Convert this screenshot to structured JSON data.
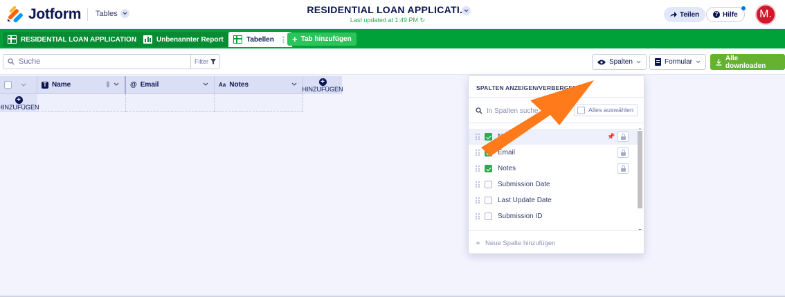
{
  "header": {
    "logo_text": "Jotform",
    "tables_label": "Tables",
    "title": "RESIDENTIAL LOAN APPLICATI...",
    "subtitle": "Last updated at 1:49 PM",
    "share_label": "Teilen",
    "help_label": "Hilfe",
    "avatar_initial": "M."
  },
  "tabs": [
    {
      "label": "RESIDENTIAL LOAN APPLICATION",
      "icon": "grid-icon"
    },
    {
      "label": "Unbenannter Report",
      "icon": "report-icon"
    },
    {
      "label": "Tabellen",
      "icon": "grid-icon",
      "active": true
    }
  ],
  "add_tab_label": "Tab hinzufügen",
  "toolbar": {
    "search_placeholder": "Suche",
    "filter_label": "Filter",
    "columns_label": "Spalten",
    "form_label": "Formular",
    "download_label": "Alle downloaden"
  },
  "table": {
    "columns": [
      {
        "label": "Name",
        "type_icon": "T"
      },
      {
        "label": "Email",
        "type_icon": "@"
      },
      {
        "label": "Notes",
        "type_icon": "Aa"
      }
    ],
    "add_column_label": "HINZUFÜGEN",
    "add_row_label": "HINZUFÜGEN"
  },
  "columns_panel": {
    "heading": "SPALTEN ANZEIGEN/VERBERGEN",
    "search_placeholder": "In Spalten suche",
    "select_all_label": "Alles auswählen",
    "items": [
      {
        "label": "Na",
        "checked": true
      },
      {
        "label": "Email",
        "checked": true
      },
      {
        "label": "Notes",
        "checked": true
      },
      {
        "label": "Submission Date",
        "checked": false
      },
      {
        "label": "Last Update Date",
        "checked": false
      },
      {
        "label": "Submission ID",
        "checked": false
      }
    ],
    "add_column_label": "Neue Spalte hinzufügen"
  },
  "colors": {
    "brand_green": "#01a13a",
    "download_green": "#64b22f",
    "annotation_arrow": "#ff7a1a",
    "avatar_red": "#d1172a"
  }
}
